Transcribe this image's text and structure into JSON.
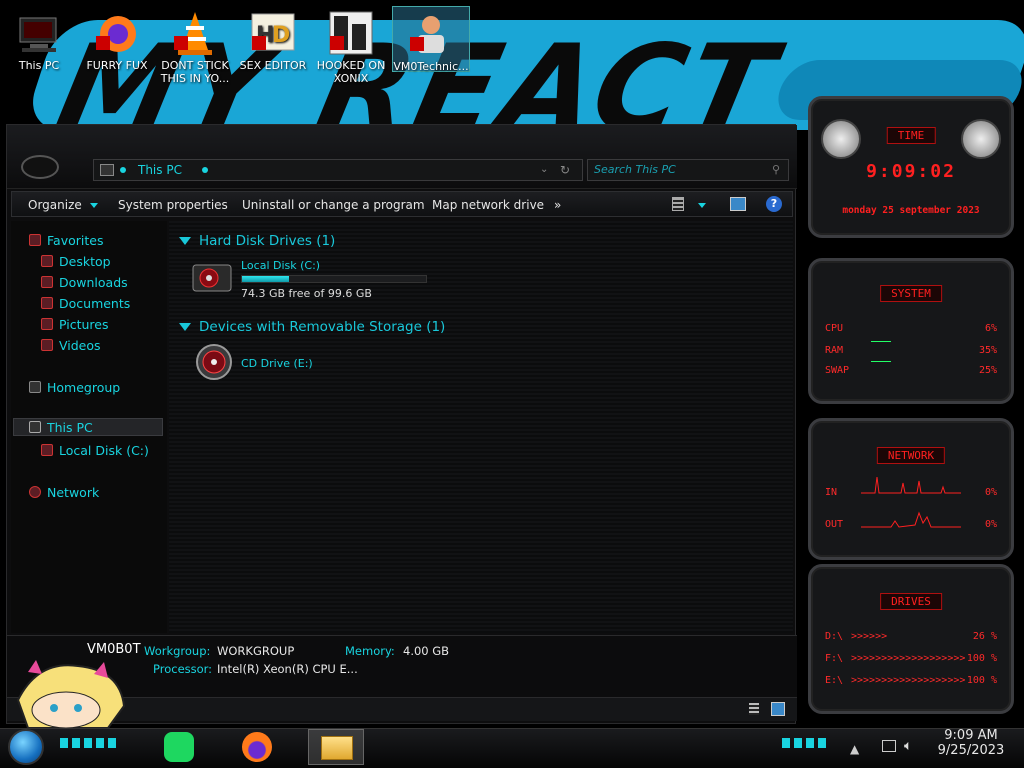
{
  "desktop": {
    "icons": [
      {
        "label": "This PC"
      },
      {
        "label": "FURRY FUX"
      },
      {
        "label": "DONT STICK THIS IN YO..."
      },
      {
        "label": "SEX EDITOR"
      },
      {
        "label": "HOOKED ON XONIX"
      },
      {
        "label": "VM0Technic..."
      }
    ]
  },
  "explorer": {
    "address": "This PC",
    "search_placeholder": "Search This PC",
    "toolbar": {
      "organize": "Organize",
      "system_properties": "System properties",
      "uninstall": "Uninstall or change a program",
      "map_drive": "Map network drive",
      "more": "»"
    },
    "nav": {
      "favorites": "Favorites",
      "desktop": "Desktop",
      "downloads": "Downloads",
      "documents": "Documents",
      "pictures": "Pictures",
      "videos": "Videos",
      "homegroup": "Homegroup",
      "this_pc": "This PC",
      "local_disk": "Local Disk (C:)",
      "network": "Network"
    },
    "groups": {
      "hdd": "Hard Disk Drives (1)",
      "removable": "Devices with Removable Storage (1)"
    },
    "drives": {
      "c_name": "Local Disk (C:)",
      "c_free": "74.3 GB free of 99.6 GB",
      "c_used_fraction": 0.254,
      "e_name": "CD Drive (E:)"
    },
    "details": {
      "computer_name": "VM0B0T",
      "workgroup_label": "Workgroup:",
      "workgroup": "WORKGROUP",
      "memory_label": "Memory:",
      "memory": "4.00 GB",
      "processor_label": "Processor:",
      "processor": "Intel(R) Xeon(R) CPU E..."
    }
  },
  "gadgets": {
    "time": {
      "title": "TIME",
      "clock": "9:09:02",
      "date": "monday 25 september 2023"
    },
    "system": {
      "title": "SYSTEM",
      "cpu_label": "CPU",
      "cpu": "6%",
      "ram_label": "RAM",
      "ram": "35%",
      "swap_label": "SWAP",
      "swap": "25%"
    },
    "network": {
      "title": "NETWORK",
      "in_label": "IN",
      "in": "0%",
      "out_label": "OUT",
      "out": "0%"
    },
    "drives": {
      "title": "DRIVES",
      "d_label": "D:\\",
      "d": "26 %",
      "f_label": "F:\\",
      "f": "100 %",
      "e_label": "E:\\",
      "e": "100 %"
    }
  },
  "taskbar": {
    "time": "9:09 AM",
    "date": "9/25/2023"
  },
  "colors": {
    "accent": "#19d4e0",
    "red": "#ff2020",
    "wallpaper_blue": "#1aa6d6"
  }
}
